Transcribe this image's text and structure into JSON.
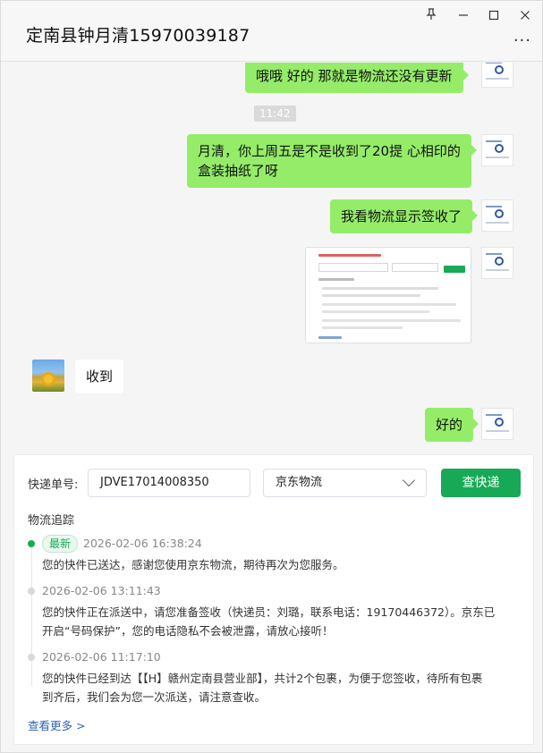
{
  "window": {
    "title": "定南县钟月清15970039187",
    "controls": {
      "pin": "pin-icon",
      "minimize": "minimize-icon",
      "maximize": "maximize-icon",
      "close": "close-icon",
      "more": "more-icon"
    }
  },
  "chat": {
    "messages": [
      {
        "from": "me",
        "text": "哦哦  好的  那就是物流还没有更新"
      },
      {
        "time": "11:42"
      },
      {
        "from": "me",
        "text_line1": "月清，你上周五是不是收到了20提  心相印的",
        "text_line2": "盒装抽纸了呀"
      },
      {
        "from": "me",
        "text": "我看物流显示签收了"
      },
      {
        "from": "me",
        "type": "image"
      },
      {
        "from": "other",
        "text": "收到"
      },
      {
        "from": "me",
        "text": "好的"
      }
    ]
  },
  "tracking": {
    "tracking_label": "快递单号:",
    "tracking_number": "JDVE17014008350",
    "carrier": "京东物流",
    "query_button": "查快递",
    "section_title": "物流追踪",
    "latest_badge": "最新",
    "events": [
      {
        "time": "2026-02-06 16:38:24",
        "lines": [
          "您的快件已送达，感谢您使用京东物流，期待再次为您服务。"
        ]
      },
      {
        "time": "2026-02-06 13:11:43",
        "lines": [
          "您的快件正在派送中，请您准备签收（快递员：刘璐，联系电话：19170446372）。京东已",
          "开启“号码保护”，您的电话隐私不会被泄露，请放心接听！"
        ]
      },
      {
        "time": "2026-02-06 11:17:10",
        "lines": [
          "您的快件已经到达【【H】赣州定南县营业部】，共计2个包裹，为便于您签收，待所有包裹",
          "到齐后，我们会为您一次派送，请注意查收。"
        ]
      }
    ],
    "view_more": "查看更多 >",
    "colors": {
      "accent": "#18a957",
      "link": "#2f64b8",
      "bubble": "#95ec69"
    }
  }
}
